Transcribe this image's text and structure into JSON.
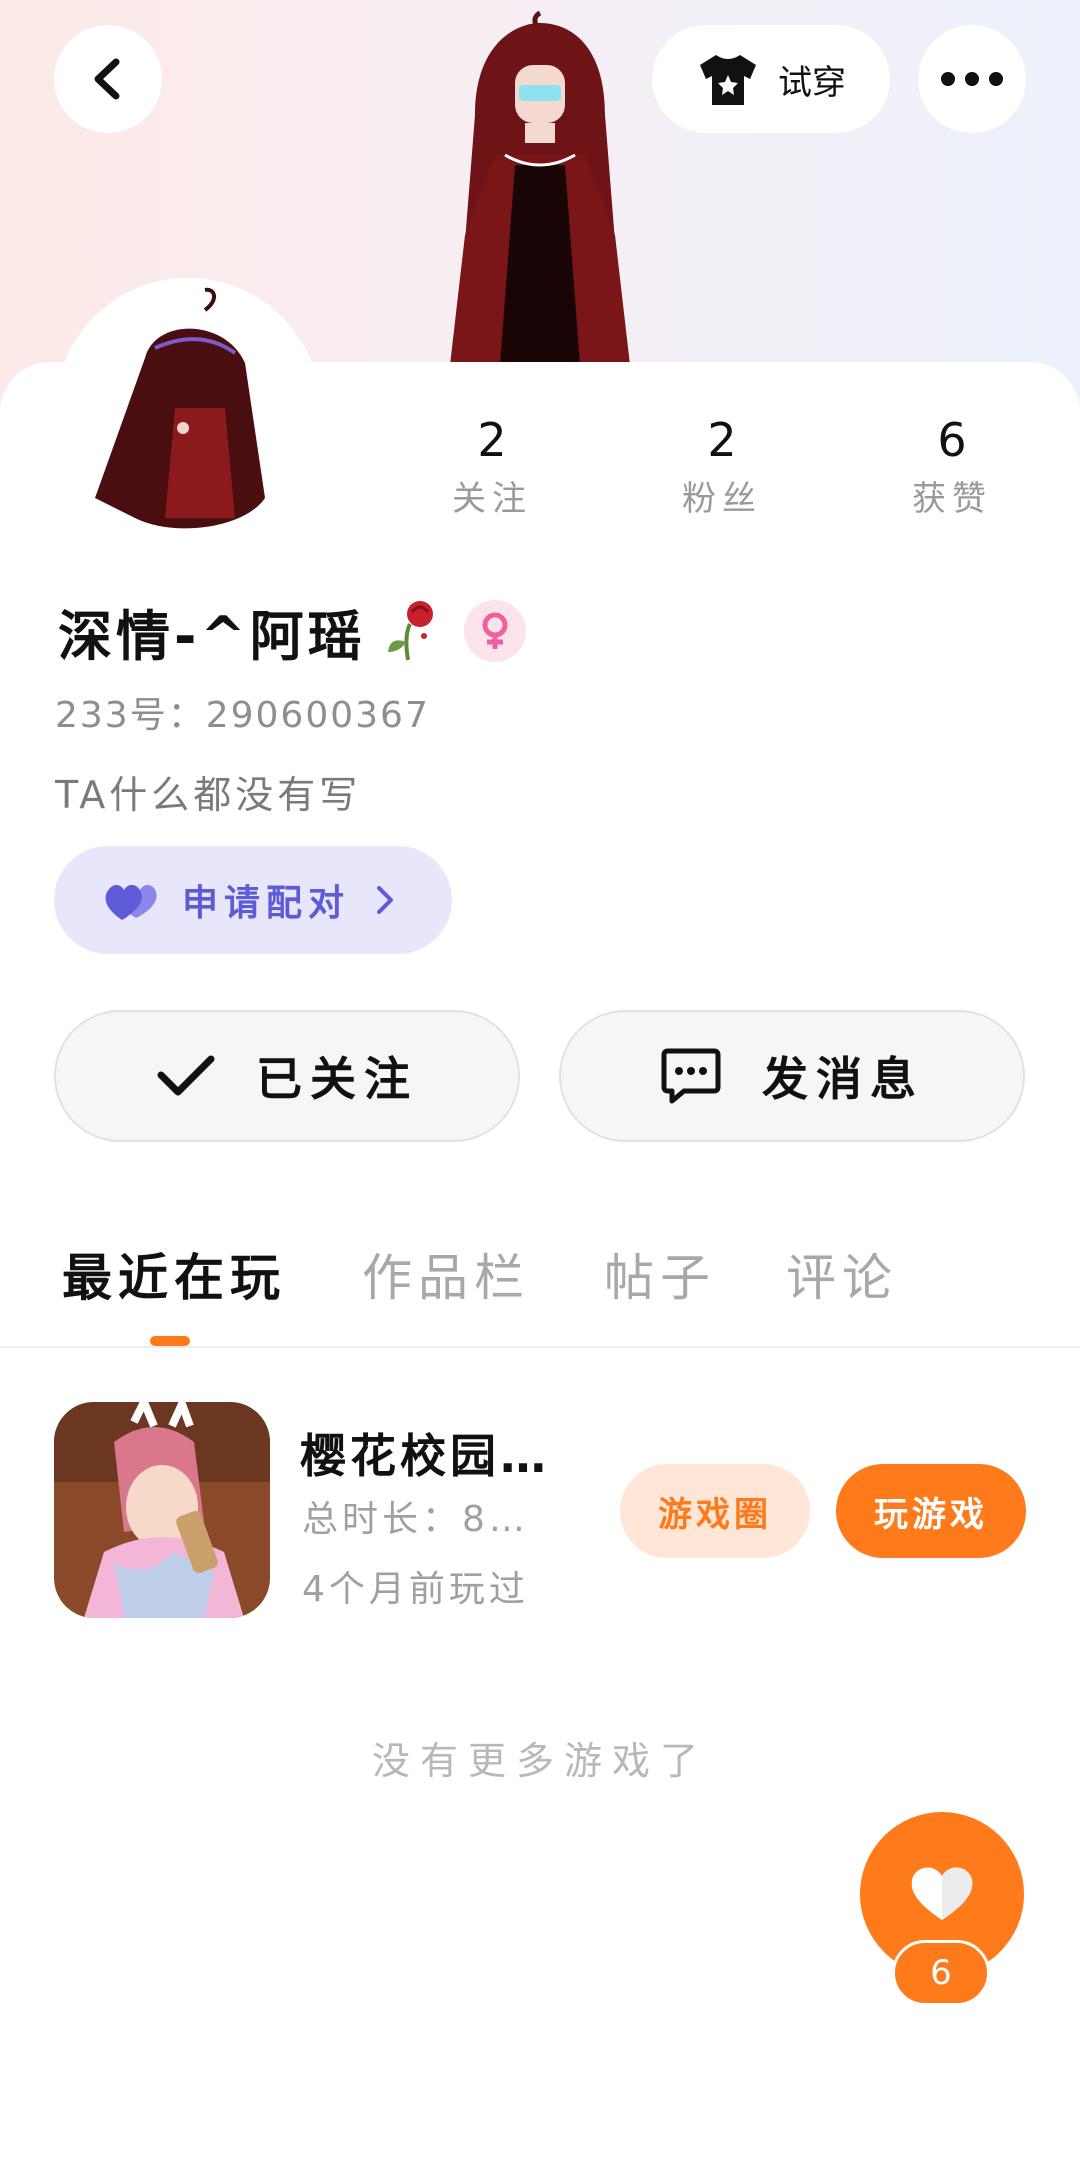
{
  "header": {
    "back_icon": "chevron-left-icon",
    "tryon_label": "试穿",
    "tryon_icon": "shirt-icon",
    "more_icon": "more-horizontal-icon"
  },
  "profile": {
    "name": "深情-^阿瑶",
    "name_decoration": "wilted-rose-emoji",
    "gender_icon": "female-icon",
    "uid": "233号：290600367",
    "bio": "TA什么都没有写",
    "stats": [
      {
        "value": "2",
        "label": "关注"
      },
      {
        "value": "2",
        "label": "粉丝"
      },
      {
        "value": "6",
        "label": "获赞"
      }
    ],
    "pair_label": "申请配对"
  },
  "actions": {
    "followed_label": "已关注",
    "message_label": "发消息"
  },
  "tabs": [
    "最近在玩",
    "作品栏",
    "帖子",
    "评论"
  ],
  "active_tab": 0,
  "games": [
    {
      "title": "樱花校园…",
      "total_time": "总时长：8…",
      "last_played": "4个月前玩过",
      "circle_label": "游戏圈",
      "play_label": "玩游戏"
    }
  ],
  "no_more_text": "没有更多游戏了",
  "likes": {
    "count": "6"
  },
  "colors": {
    "accent": "#ff7a1a",
    "pair_bg": "#e7e6fb",
    "pair_text": "#5f5bd6"
  }
}
